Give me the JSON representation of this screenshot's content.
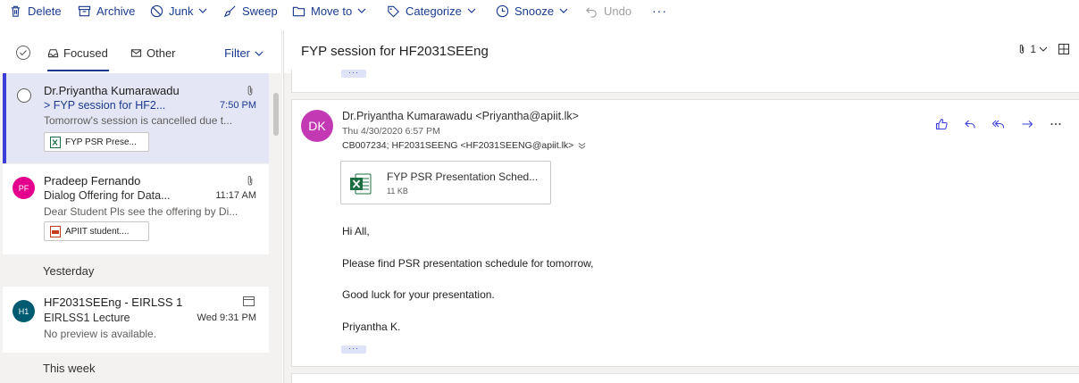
{
  "toolbar": {
    "delete": "Delete",
    "archive": "Archive",
    "junk": "Junk",
    "sweep": "Sweep",
    "move_to": "Move to",
    "categorize": "Categorize",
    "snooze": "Snooze",
    "undo": "Undo",
    "more": "···"
  },
  "list": {
    "tabs": {
      "focused": "Focused",
      "other": "Other",
      "filter": "Filter"
    },
    "items": [
      {
        "sender": "Dr.Priyantha Kumarawadu",
        "subject": "> FYP session for HF2...",
        "time": "7:50 PM",
        "preview": "Tomorrow's session is cancelled due t...",
        "attachment": "FYP PSR Prese...",
        "selected": true
      },
      {
        "initials": "PF",
        "avatar_color": "#e3008c",
        "sender": "Pradeep Fernando",
        "subject": "Dialog Offering for Data...",
        "time": "11:17 AM",
        "preview": "Dear Student Pls see the offering by Di...",
        "attachment": "APIIT student...."
      },
      {
        "initials": "H1",
        "avatar_color": "#005b70",
        "sender": "HF2031SEEng - EIRLSS 1",
        "subject": "EIRLSS1 Lecture",
        "time": "Wed 9:31 PM",
        "preview": "No preview is available."
      }
    ],
    "groups": {
      "yesterday": "Yesterday",
      "this_week": "This week"
    }
  },
  "reading": {
    "title": "FYP session for HF2031SEEng",
    "attachment_count": "1",
    "collapsed_dots": "···",
    "message": {
      "initials": "DK",
      "avatar_color": "#c239b3",
      "from": "Dr.Priyantha Kumarawadu <Priyantha@apiit.lk>",
      "date": "Thu 4/30/2020 6:57 PM",
      "to": "CB007234; HF2031SEENG <HF2031SEENG@apiit.lk>",
      "attachment": {
        "name": "FYP PSR Presentation Sched...",
        "size": "11 KB"
      },
      "body": [
        "Hi All,",
        "Please find PSR presentation schedule for tomorrow,",
        "Good luck for your presentation.",
        "Priyantha K."
      ]
    }
  },
  "colors": {
    "accent": "#1a3a8f",
    "selection": "#3b3fd8",
    "excel": "#1d6f42"
  }
}
